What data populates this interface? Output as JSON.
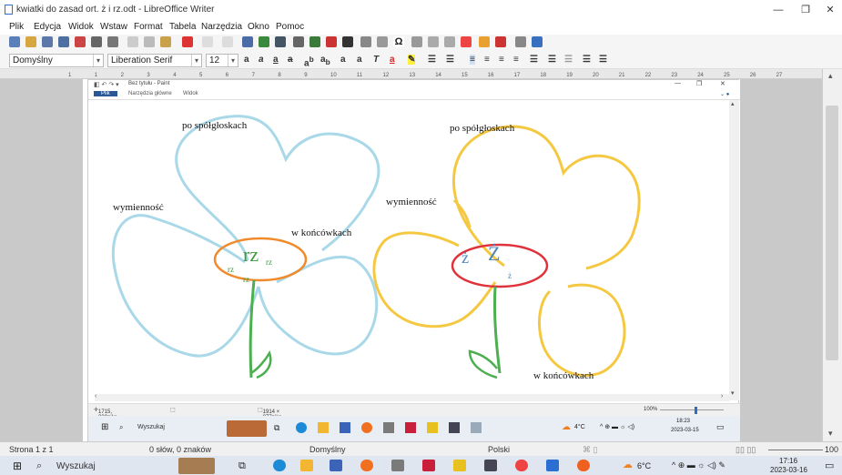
{
  "window": {
    "title": "kwiatki do zasad ort. ż i rz.odt - LibreOffice Writer"
  },
  "menu": [
    "Plik",
    "Edycja",
    "Widok",
    "Wstaw",
    "Format",
    "Tabela",
    "Narzędzia",
    "Okno",
    "Pomoc"
  ],
  "format_bar": {
    "style": "Domyślny",
    "font": "Liberation Serif",
    "size": "12"
  },
  "ruler_ticks": [
    "1",
    "1",
    "2",
    "3",
    "4",
    "5",
    "6",
    "7",
    "8",
    "9",
    "10",
    "11",
    "12",
    "13",
    "14",
    "15",
    "16",
    "17",
    "18",
    "19",
    "20",
    "21",
    "22",
    "23",
    "24",
    "25",
    "26",
    "27"
  ],
  "paint": {
    "title": "Bez tytułu - Paint",
    "tabs": [
      "Plik",
      "Narzędzia główne",
      "Widok"
    ],
    "status_coords": "1715, 330piks.",
    "status_size": "1914 × 877piks.",
    "zoom": "100%",
    "inner_search": "Wyszukaj",
    "inner_weather": "4°C",
    "inner_time": "18:23",
    "inner_date": "2023-03-15"
  },
  "drawing": {
    "rz_flower": {
      "top": "po spółgłoskach",
      "left": "wymienność",
      "right": "w końcówkach",
      "center": "rz",
      "small_left": "rz",
      "small_right": "rz",
      "small_bottom": "rz"
    },
    "z_flower": {
      "top": "po spółgłoskach",
      "left": "wymienność",
      "bottom": "w końcówkach",
      "center_left": "ż",
      "center_big": "Ż",
      "small": "ż"
    }
  },
  "statusbar": {
    "page": "Strona 1 z 1",
    "words": "0 słów, 0 znaków",
    "style": "Domyślny",
    "language": "Polski",
    "zoom": "100"
  },
  "taskbar": {
    "search": "Wyszukaj",
    "weather": "6°C",
    "time": "17:16",
    "date": "2023-03-16"
  },
  "colors": {
    "petal_blue": "#a9d8e8",
    "petal_yellow": "#f5c842",
    "ellipse_orange": "#f08a2a",
    "ellipse_red": "#e0323a",
    "stem_green": "#4caf50",
    "rz_text_green": "#3d9a3d",
    "z_text_blue": "#4b86b8"
  }
}
